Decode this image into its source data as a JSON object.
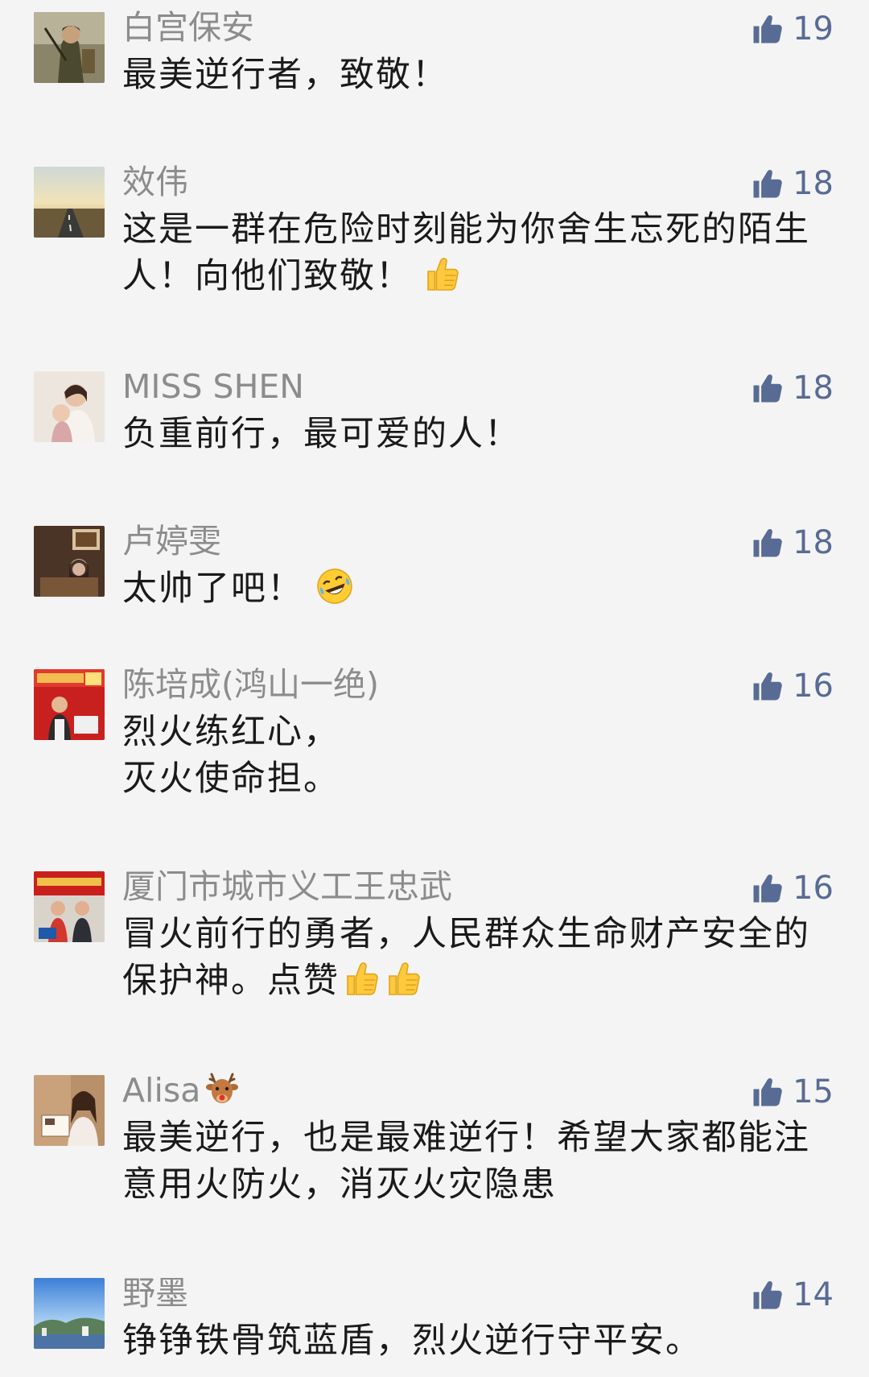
{
  "comments": [
    {
      "nickname": "白宫保安",
      "likes": "19",
      "lines": [
        "最美逆行者，致敬！"
      ]
    },
    {
      "nickname": "效伟",
      "likes": "18",
      "lines": [
        "这是一群在危险时刻能为你舍生忘死的陌生",
        "人！向他们致敬！"
      ],
      "emoji": "thumbs-up"
    },
    {
      "nickname": "MISS SHEN",
      "likes": "18",
      "lines": [
        "负重前行，最可爱的人！"
      ]
    },
    {
      "nickname": "卢婷雯",
      "likes": "18",
      "lines": [
        "太帅了吧！"
      ],
      "emoji": "laughing-crying"
    },
    {
      "nickname": "陈培成(鸿山一绝)",
      "likes": "16",
      "lines": [
        "烈火练红心，",
        "灭火使命担。"
      ]
    },
    {
      "nickname": "厦门市城市义工王忠武",
      "likes": "16",
      "lines": [
        "冒火前行的勇者，人民群众生命财产安全的",
        "保护神。点赞"
      ],
      "emoji": "thumbs-up x2"
    },
    {
      "nickname": "Alisa",
      "nickname_emoji": "deer",
      "likes": "15",
      "lines": [
        "最美逆行，也是最难逆行！希望大家都能注",
        "意用火防火，消灭火灾隐患"
      ]
    },
    {
      "nickname": "野墨",
      "likes": "14",
      "lines": [
        "铮铮铁骨筑蓝盾，烈火逆行守平安。"
      ]
    }
  ],
  "colors": {
    "background": "#f4f4f4",
    "nickname": "#8c8c8c",
    "text": "#1a1a1a",
    "like": "#576b95"
  },
  "icons": {
    "like": "thumbs-up-icon"
  }
}
